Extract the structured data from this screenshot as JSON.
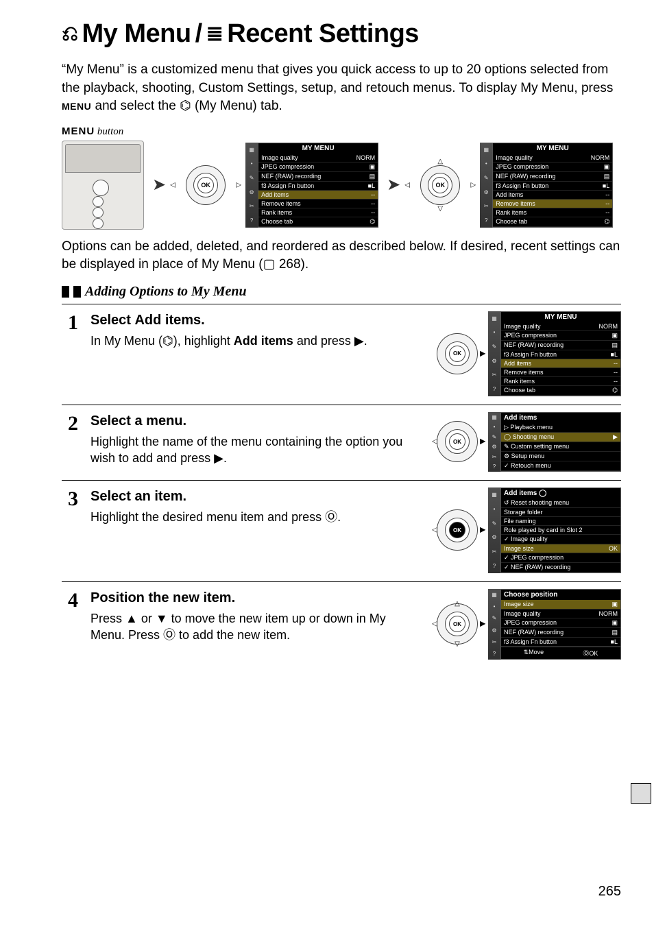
{
  "page": {
    "title_left": "My Menu",
    "title_sep": "/",
    "title_right": "Recent Settings",
    "intro": "“My Menu” is a customized menu that gives you quick access to up to 20 options selected from the playback, shooting, Custom Settings, setup, and retouch menus. To display My Menu, press ",
    "intro_menu": "MENU",
    "intro_tail": " and select the ⌬ (My Menu) tab.",
    "menu_button_label": "MENU",
    "menu_button_suffix": " button",
    "mid": "Options can be added, deleted, and reordered as described below.  If desired, recent settings can be displayed in place of My Menu (▢ 268).",
    "section_heading": "Adding Options to My Menu",
    "page_number": "265"
  },
  "top_screens": {
    "title": "MY MENU",
    "rows": [
      {
        "l": "Image quality",
        "r": "NORM"
      },
      {
        "l": "JPEG compression",
        "r": "▣"
      },
      {
        "l": "NEF (RAW) recording",
        "r": "▤"
      },
      {
        "l": "f3 Assign Fn button",
        "r": "■L"
      },
      {
        "l": "Add items",
        "r": "--"
      },
      {
        "l": "Remove items",
        "r": "--"
      },
      {
        "l": "Rank items",
        "r": "--"
      },
      {
        "l": "Choose tab",
        "r": "⌬"
      }
    ]
  },
  "ok_label": "OK",
  "steps": [
    {
      "num": "1",
      "title": "Select Add items.",
      "pre": "In My Menu (⌬), highlight ",
      "bold": "Add items",
      "post": " and press ▶.",
      "screen": {
        "title": "MY MENU",
        "rows": [
          {
            "l": "Image quality",
            "r": "NORM",
            "sel": false
          },
          {
            "l": "JPEG compression",
            "r": "▣",
            "sel": false
          },
          {
            "l": "NEF (RAW) recording",
            "r": "▤",
            "sel": false
          },
          {
            "l": "f3 Assign Fn button",
            "r": "■L",
            "sel": false
          },
          {
            "l": "Add items",
            "r": "--",
            "sel": true
          },
          {
            "l": "Remove items",
            "r": "--",
            "sel": false
          },
          {
            "l": "Rank items",
            "r": "--",
            "sel": false
          },
          {
            "l": "Choose tab",
            "r": "⌬",
            "sel": false
          }
        ]
      },
      "arrows": {
        "up": false,
        "down": false,
        "left": false,
        "right": true
      }
    },
    {
      "num": "2",
      "title": "Select a menu.",
      "text": "Highlight the name of the menu containing the option you wish to add and press ▶.",
      "screen": {
        "title": "Add items",
        "rows": [
          {
            "l": "▷  Playback menu",
            "r": "",
            "sel": false
          },
          {
            "l": "◯  Shooting menu",
            "r": "▶",
            "sel": true
          },
          {
            "l": "✎  Custom setting menu",
            "r": "",
            "sel": false
          },
          {
            "l": "⚙  Setup menu",
            "r": "",
            "sel": false
          },
          {
            "l": "✓  Retouch menu",
            "r": "",
            "sel": false
          }
        ],
        "title_align": "left"
      },
      "arrows": {
        "up": false,
        "down": false,
        "left": true,
        "right": true
      }
    },
    {
      "num": "3",
      "title": "Select an item.",
      "text": "Highlight the desired menu item and press Ⓞ.",
      "screen": {
        "title": "Add items ◯",
        "rows": [
          {
            "l": "↺  Reset shooting menu",
            "r": "",
            "sel": false
          },
          {
            "l": "    Storage folder",
            "r": "",
            "sel": false
          },
          {
            "l": "    File naming",
            "r": "",
            "sel": false
          },
          {
            "l": "    Role played by card in Slot 2",
            "r": "",
            "sel": false
          },
          {
            "l": "✓  Image quality",
            "r": "",
            "sel": false
          },
          {
            "l": "    Image size",
            "r": "OK",
            "sel": true
          },
          {
            "l": "✓  JPEG compression",
            "r": "",
            "sel": false
          },
          {
            "l": "✓  NEF (RAW) recording",
            "r": "",
            "sel": false
          }
        ],
        "title_align": "left"
      },
      "arrows": {
        "up": false,
        "down": false,
        "left": true,
        "right": true,
        "ok_fill": true
      }
    },
    {
      "num": "4",
      "title": "Position the new item.",
      "text": "Press ▲ or ▼ to move the new item up or down in My Menu.  Press Ⓞ to add the new item.",
      "screen": {
        "title": "Choose position",
        "rows": [
          {
            "l": "Image size",
            "r": "▣",
            "sel": true
          },
          {
            "l": "Image quality",
            "r": "NORM",
            "sel": false
          },
          {
            "l": "JPEG compression",
            "r": "▣",
            "sel": false
          },
          {
            "l": "NEF (RAW) recording",
            "r": "▤",
            "sel": false
          },
          {
            "l": "f3 Assign Fn button",
            "r": "■L",
            "sel": false
          }
        ],
        "footer_left": "⇅Move",
        "footer_right": "ⓄOK",
        "title_align": "left"
      },
      "arrows": {
        "up": true,
        "down": true,
        "left": true,
        "right": true
      }
    }
  ]
}
